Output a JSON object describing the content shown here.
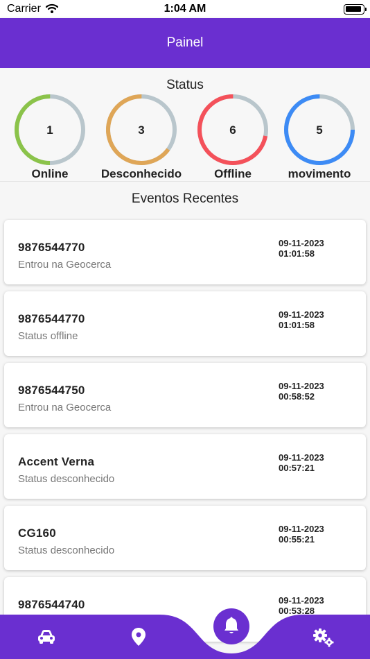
{
  "status_bar": {
    "carrier": "Carrier",
    "time": "1:04 AM"
  },
  "app_bar": {
    "title": "Painel",
    "color": "#6a2fd0"
  },
  "status": {
    "title": "Status",
    "gauges": [
      {
        "value": "1",
        "label": "Online",
        "fraction": 0.5,
        "color": "#8bc34a"
      },
      {
        "value": "3",
        "label": "Desconhecido",
        "fraction": 0.65,
        "color": "#dfa657"
      },
      {
        "value": "6",
        "label": "Offline",
        "fraction": 0.72,
        "color": "#f4515a"
      },
      {
        "value": "5",
        "label": "movimento",
        "fraction": 0.75,
        "color": "#3d8bf5"
      }
    ],
    "track_color": "#b9c6cc"
  },
  "events": {
    "title": "Eventos Recentes",
    "items": [
      {
        "title": "9876544770",
        "subtitle": "Entrou na Geocerca",
        "date": "09-11-2023",
        "time": "01:01:58"
      },
      {
        "title": "9876544770",
        "subtitle": "Status offline",
        "date": "09-11-2023",
        "time": "01:01:58"
      },
      {
        "title": "9876544750",
        "subtitle": "Entrou na Geocerca",
        "date": "09-11-2023",
        "time": "00:58:52"
      },
      {
        "title": "Accent Verna",
        "subtitle": "Status desconhecido",
        "date": "09-11-2023",
        "time": "00:57:21"
      },
      {
        "title": "CG160",
        "subtitle": "Status desconhecido",
        "date": "09-11-2023",
        "time": "00:55:21"
      },
      {
        "title": "9876544740",
        "subtitle": "",
        "date": "09-11-2023",
        "time": "00:53:28"
      }
    ]
  },
  "bottom_nav": {
    "items": [
      {
        "icon": "car-icon"
      },
      {
        "icon": "map-pin-icon"
      },
      {
        "icon": "bell-icon",
        "active": true
      },
      {
        "icon": "settings-icon"
      }
    ]
  }
}
